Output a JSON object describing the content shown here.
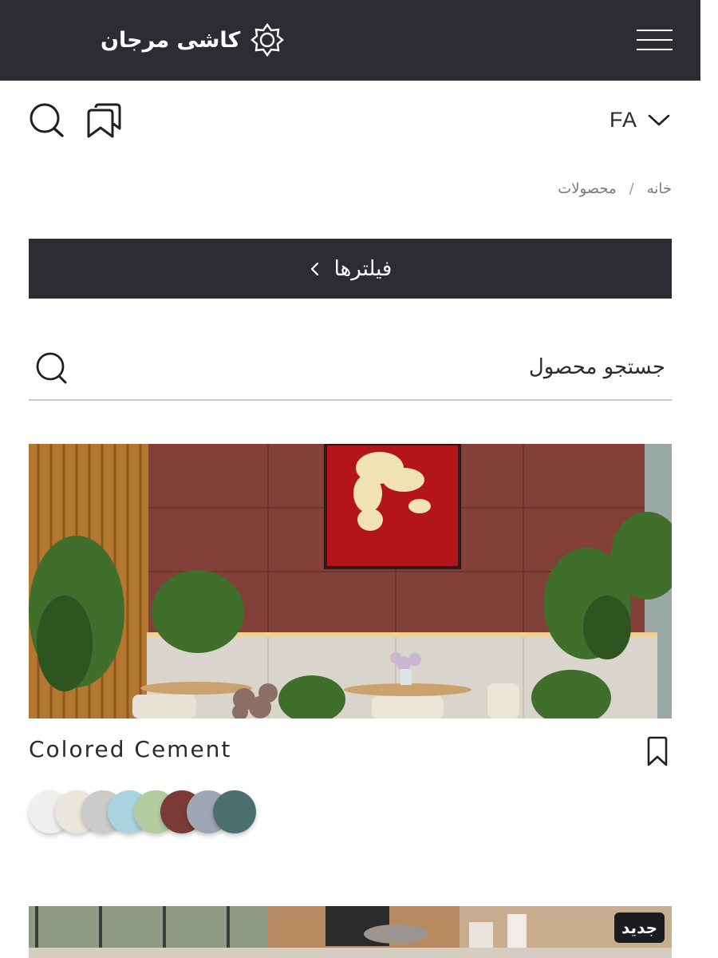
{
  "header": {
    "brand_name": "کاشی مرجان",
    "logo_icon": "marjan-logo-icon",
    "menu_icon": "hamburger-menu-icon",
    "background_color": "#2b2d33"
  },
  "toolbar": {
    "language": "FA",
    "search_icon": "search-icon",
    "bookmarks_icon": "bookmarks-icon"
  },
  "breadcrumb": {
    "items": [
      "خانه",
      "محصولات"
    ],
    "separator": "/"
  },
  "filters": {
    "label": "فیلترها"
  },
  "search": {
    "placeholder": "جستجو محصول"
  },
  "products": [
    {
      "title": "Colored Cement",
      "bookmark_icon": "bookmark-icon",
      "swatches": [
        "#efefef",
        "#e9e6db",
        "#c9ccc8",
        "#a9d3e0",
        "#b3cb9f",
        "#7a3b36",
        "#9ea6b6",
        "#4c6f6f"
      ]
    },
    {
      "badge": "جدید"
    }
  ]
}
